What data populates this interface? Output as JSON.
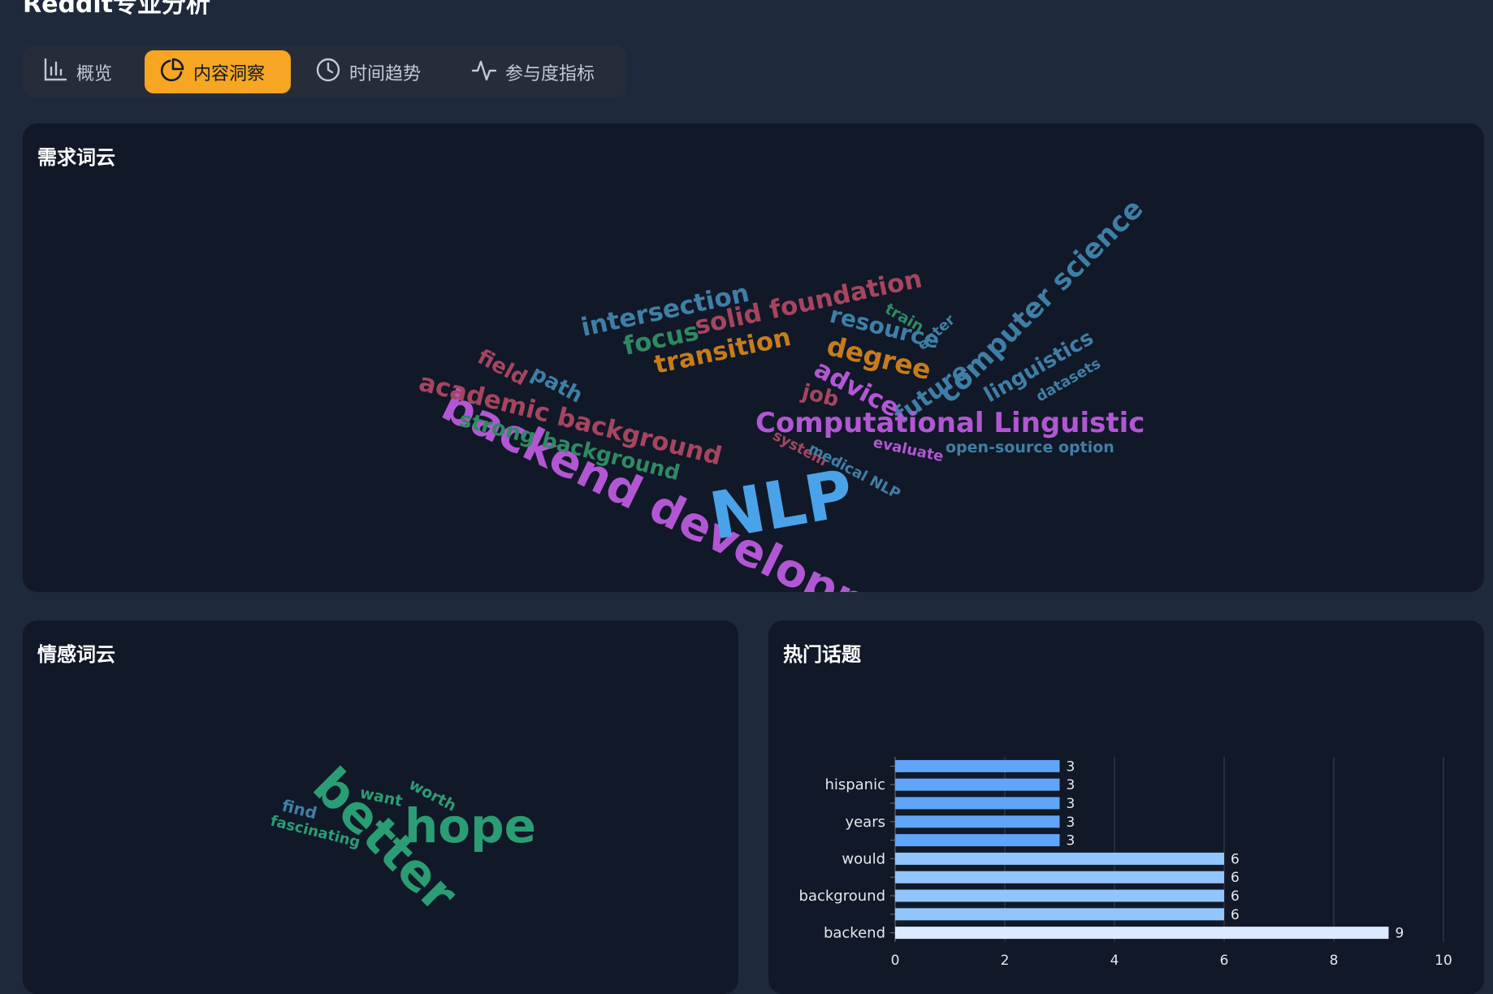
{
  "header": {
    "title": "Reddit专业分析"
  },
  "tabs": [
    {
      "label": "概览",
      "icon": "bar-chart-icon",
      "active": false
    },
    {
      "label": "内容洞察",
      "icon": "pie-chart-icon",
      "active": true
    },
    {
      "label": "时间趋势",
      "icon": "clock-icon",
      "active": false
    },
    {
      "label": "参与度指标",
      "icon": "activity-icon",
      "active": false
    }
  ],
  "demand_cloud": {
    "title": "需求词云",
    "words": [
      {
        "text": "backend development",
        "color": "#b257d3"
      },
      {
        "text": "NLP",
        "color": "#4aa3e8"
      },
      {
        "text": "intersection",
        "color": "#3f7fa6"
      },
      {
        "text": "solid foundation",
        "color": "#a6455f"
      },
      {
        "text": "focus",
        "color": "#2f8a63"
      },
      {
        "text": "transition",
        "color": "#c77c1c"
      },
      {
        "text": "resource",
        "color": "#3f7fa6"
      },
      {
        "text": "train",
        "color": "#2f8a63"
      },
      {
        "text": "enter",
        "color": "#3f7fa6"
      },
      {
        "text": "degree",
        "color": "#c77c1c"
      },
      {
        "text": "computer science",
        "color": "#3f7fa6"
      },
      {
        "text": "linguistics",
        "color": "#3f7fa6"
      },
      {
        "text": "datasets",
        "color": "#3f7fa6"
      },
      {
        "text": "future",
        "color": "#3f7fa6"
      },
      {
        "text": "advice",
        "color": "#b257d3"
      },
      {
        "text": "job",
        "color": "#a6455f"
      },
      {
        "text": "field",
        "color": "#a6455f"
      },
      {
        "text": "path",
        "color": "#3f7fa6"
      },
      {
        "text": "academic background",
        "color": "#a6455f"
      },
      {
        "text": "strong background",
        "color": "#2f8a63"
      },
      {
        "text": "Computational Linguistic",
        "color": "#b257d3"
      },
      {
        "text": "open-source option",
        "color": "#3f7fa6"
      },
      {
        "text": "evaluate",
        "color": "#b257d3"
      },
      {
        "text": "system",
        "color": "#a6455f"
      },
      {
        "text": "medical NLP",
        "color": "#3f7fa6"
      }
    ]
  },
  "sentiment_cloud": {
    "title": "情感词云",
    "words": [
      {
        "text": "better",
        "color": "#2a9d74"
      },
      {
        "text": "hope",
        "color": "#2a9d74"
      },
      {
        "text": "want",
        "color": "#2a9d74"
      },
      {
        "text": "worth",
        "color": "#2a9d74"
      },
      {
        "text": "find",
        "color": "#3f7fa6"
      },
      {
        "text": "fascinating",
        "color": "#2a9d74"
      }
    ]
  },
  "hot_topics": {
    "title": "热门话题",
    "chart_data": {
      "type": "bar",
      "orientation": "horizontal",
      "title": "热门话题",
      "categories": [
        "c1",
        "hispanic",
        "c3",
        "years",
        "c5",
        "would",
        "c7",
        "background",
        "c9",
        "backend"
      ],
      "category_labels": [
        "",
        "hispanic",
        "",
        "years",
        "",
        "would",
        "",
        "background",
        "",
        "backend"
      ],
      "values": [
        3,
        3,
        3,
        3,
        3,
        6,
        6,
        6,
        6,
        9
      ],
      "bar_colors": [
        "#60a5fa",
        "#60a5fa",
        "#60a5fa",
        "#60a5fa",
        "#60a5fa",
        "#93c5fd",
        "#93c5fd",
        "#93c5fd",
        "#93c5fd",
        "#dbeafe"
      ],
      "xlim": [
        0,
        10
      ],
      "xticks": [
        0,
        2,
        4,
        6,
        8,
        10
      ],
      "grid": true
    }
  }
}
